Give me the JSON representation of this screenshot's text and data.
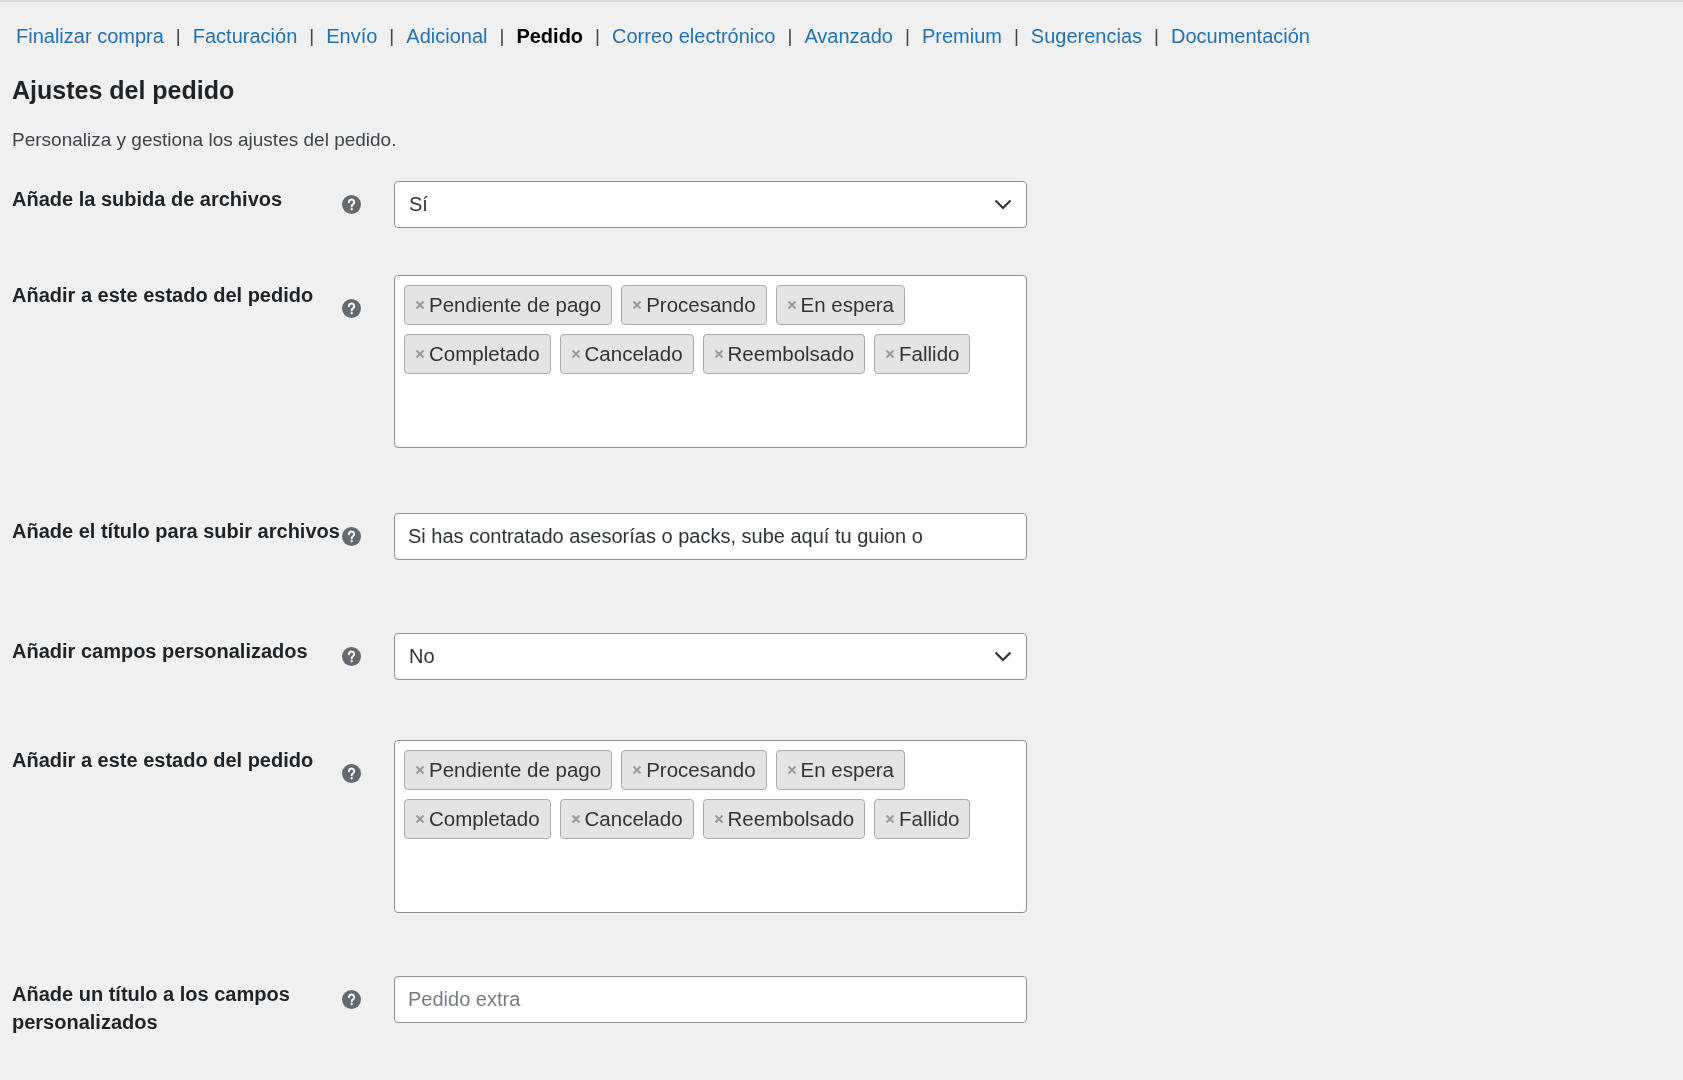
{
  "nav": [
    {
      "label": "Finalizar compra",
      "selected": false
    },
    {
      "label": "Facturación",
      "selected": false
    },
    {
      "label": "Envío",
      "selected": false
    },
    {
      "label": "Adicional",
      "selected": false
    },
    {
      "label": "Pedido",
      "selected": true
    },
    {
      "label": "Correo electrónico",
      "selected": false
    },
    {
      "label": "Avanzado",
      "selected": false
    },
    {
      "label": "Premium",
      "selected": false
    },
    {
      "label": "Sugerencias",
      "selected": false
    },
    {
      "label": "Documentación",
      "selected": false
    }
  ],
  "nav_separator": "|",
  "title": "Ajustes del pedido",
  "description": "Personaliza y gestiona los ajustes del pedido.",
  "settings": [
    {
      "kind": "select",
      "label": "Añade la subida de archivos",
      "value": "Sí"
    },
    {
      "kind": "multiselect",
      "label": "Añadir a este estado del pedido",
      "tags": [
        "Pendiente de pago",
        "Procesando",
        "En espera",
        "Completado",
        "Cancelado",
        "Reembolsado",
        "Fallido"
      ]
    },
    {
      "kind": "text",
      "label": "Añade el título para subir archivos",
      "value": "Si has contratado asesorías o packs, sube aquí tu guion o"
    },
    {
      "kind": "select",
      "label": "Añadir campos personalizados",
      "value": "No"
    },
    {
      "kind": "multiselect",
      "label": "Añadir a este estado del pedido",
      "tags": [
        "Pendiente de pago",
        "Procesando",
        "En espera",
        "Completado",
        "Cancelado",
        "Reembolsado",
        "Fallido"
      ]
    },
    {
      "kind": "text",
      "label": "Añade un título a los campos personalizados",
      "placeholder": "Pedido extra"
    }
  ]
}
